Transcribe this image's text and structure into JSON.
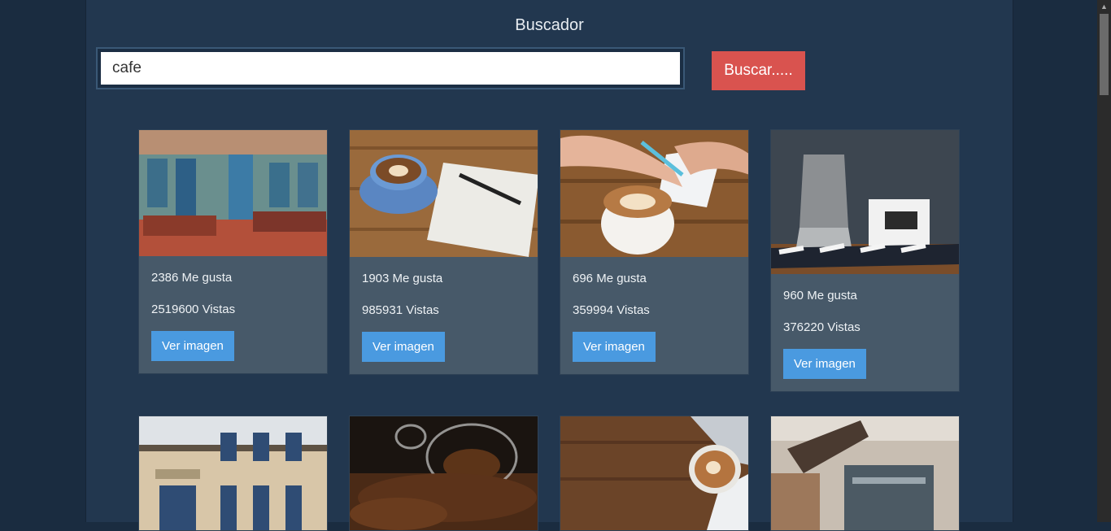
{
  "header": {
    "title": "Buscador"
  },
  "search": {
    "value": "cafe",
    "button_label": "Buscar....."
  },
  "card_button_label": "Ver imagen",
  "cards": [
    {
      "likes": "2386 Me gusta",
      "views": "2519600 Vistas",
      "image_icon": "cafe-storefront-photo"
    },
    {
      "likes": "1903 Me gusta",
      "views": "985931 Vistas",
      "image_icon": "coffee-cup-notebook-photo"
    },
    {
      "likes": "696 Me gusta",
      "views": "359994 Vistas",
      "image_icon": "latte-writing-photo"
    },
    {
      "likes": "960 Me gusta",
      "views": "376220 Vistas",
      "image_icon": "moka-pot-mug-photo"
    },
    {
      "image_icon": "hotel-facade-photo"
    },
    {
      "image_icon": "coffee-beans-cup-photo"
    },
    {
      "image_icon": "latte-laptop-photo"
    },
    {
      "image_icon": "espresso-machine-photo"
    }
  ],
  "colors": {
    "background": "#1a2c40",
    "panel": "#22374f",
    "card": "#475969",
    "search_button": "#d9534f",
    "card_button": "#4a9ae0"
  }
}
